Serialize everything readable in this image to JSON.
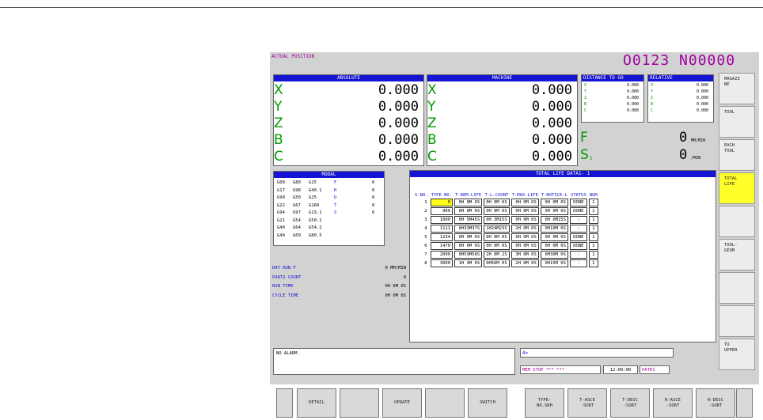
{
  "screen_title": "ACTUAL POSITION",
  "program": "O0123 N00000",
  "absolute": {
    "title": "ABSOLUTE",
    "axes": [
      {
        "name": "X",
        "value": "0.000"
      },
      {
        "name": "Y",
        "value": "0.000"
      },
      {
        "name": "Z",
        "value": "0.000"
      },
      {
        "name": "B",
        "value": "0.000"
      },
      {
        "name": "C",
        "value": "0.000"
      }
    ]
  },
  "machine": {
    "title": "MACHINE",
    "axes": [
      {
        "name": "X",
        "value": "0.000"
      },
      {
        "name": "Y",
        "value": "0.000"
      },
      {
        "name": "Z",
        "value": "0.000"
      },
      {
        "name": "B",
        "value": "0.000"
      },
      {
        "name": "C",
        "value": "0.000"
      }
    ]
  },
  "distance": {
    "title": "DISTANCE TO GO",
    "axes": [
      {
        "name": "X",
        "value": "0.000"
      },
      {
        "name": "Y",
        "value": "0.000"
      },
      {
        "name": "Z",
        "value": "0.000"
      },
      {
        "name": "B",
        "value": "0.000"
      },
      {
        "name": "C",
        "value": "0.000"
      }
    ]
  },
  "relative": {
    "title": "RELATIVE",
    "axes": [
      {
        "name": "X",
        "value": "0.000"
      },
      {
        "name": "Y",
        "value": "0.000"
      },
      {
        "name": "Z",
        "value": "0.000"
      },
      {
        "name": "B",
        "value": "0.000"
      },
      {
        "name": "C",
        "value": "0.000"
      }
    ]
  },
  "feed": {
    "label": "F",
    "value": "0",
    "unit": "MM/MIN"
  },
  "spindle": {
    "label": "S",
    "sub": "1",
    "value": "0",
    "unit": "/MIN"
  },
  "modal": {
    "title": "MODAL",
    "rows": [
      {
        "c1": "G00",
        "c2": "G80",
        "c3": "G15",
        "ch": "F",
        "n": "0"
      },
      {
        "c1": "G17",
        "c2": "G98",
        "c3": "G40.1",
        "ch": "H",
        "n": "0"
      },
      {
        "c1": "G90",
        "c2": "G50",
        "c3": "G25",
        "ch": "D",
        "n": "0"
      },
      {
        "c1": "G22",
        "c2": "G67",
        "c3": "G160",
        "ch": "T",
        "n": "0"
      },
      {
        "c1": "G94",
        "c2": "G97",
        "c3": "G13.1",
        "ch": "S",
        "n": "0"
      },
      {
        "c1": "G21",
        "c2": "G54",
        "c3": "G50.1",
        "ch": "",
        "n": ""
      },
      {
        "c1": "G40",
        "c2": "G64",
        "c3": "G54.2",
        "ch": "",
        "n": ""
      },
      {
        "c1": "G49",
        "c2": "G69",
        "c3": "G80.5",
        "ch": "",
        "n": ""
      }
    ]
  },
  "info": {
    "dry_run_label": "DRY RUN F",
    "dry_run_value": "0 MM/MIN",
    "parts_label": "PARTS COUNT",
    "parts_value": "0",
    "run_label": "RUN TIME",
    "run_value": "0H 0M 0S",
    "cycle_label": "CYCLE TIME",
    "cycle_value": "0H 0M 0S"
  },
  "life": {
    "title": "TOTAL LIFE DATA1-  1",
    "headers": [
      "S-NO.",
      "TYPE NO.",
      "T-REM-LIFE",
      "T-L-COUNT",
      "T-MAX-LIFE",
      "T-NOTICE-L",
      "STATUS",
      "NUM"
    ],
    "rows": [
      [
        "1",
        "0",
        "0H 0M 0S",
        "0H 0M 0S",
        "0H 0M 0S",
        "0H 0M 0S",
        "DONE",
        "1"
      ],
      [
        "2",
        "900",
        "0H 0M 0S",
        "0H 0M 0S",
        "0H 0M 0S",
        "0H 0M 0S",
        "DONE",
        "1"
      ],
      [
        "3",
        "1000",
        "0H 5M45S",
        "0H 3M15S",
        "0H 9M 0S",
        "0H 0M15S",
        "-",
        "1"
      ],
      [
        "4",
        "1111",
        "0H33M37S",
        "1H24M23S",
        "2H 0M 0S",
        "0H10M 0S",
        "-",
        "1"
      ],
      [
        "5",
        "1234",
        "0H 0M 0S",
        "0H 0M 0S",
        "0H 0M 0S",
        "0H 0M 0S",
        "DONE",
        "1"
      ],
      [
        "6",
        "1470",
        "0H 0M 0S",
        "0H 0M 0S",
        "0H 0M 0S",
        "0H 0M 0S",
        "DONE",
        "1"
      ],
      [
        "7",
        "2000",
        "0H59M58S",
        "2H 0M 2S",
        "3H 0M 0S",
        "0H30M 0S",
        "-",
        "1"
      ],
      [
        "8",
        "3000",
        "1H 4M 0S",
        "0H56M 0S",
        "2H 0M 0S",
        "0H15M 0S",
        "-",
        "1"
      ]
    ]
  },
  "alarm": "NO ALARM.",
  "input_prompt": "A>",
  "status": {
    "mode": "MEM",
    "state": "STOP",
    "stars": "*** ***",
    "time": "12:00:00",
    "path": "PATH1"
  },
  "side_keys": [
    "MAGAZI\nNE",
    "TOOL",
    "EACH\nTOOL",
    "TOTAL\nLIFE",
    "",
    "TOOL-\nGEOM",
    "",
    "",
    "TO\nUPPER"
  ],
  "bottom_keys": [
    "DETAIL",
    "",
    "UPDATE",
    "",
    "SWITCH",
    "TYPE-\nNO.SRH",
    "T-ASCE\n-SORT",
    "T-DESC\n-SORT",
    "R-ASCE\n-SORT",
    "R-DESC\n-SORT"
  ]
}
